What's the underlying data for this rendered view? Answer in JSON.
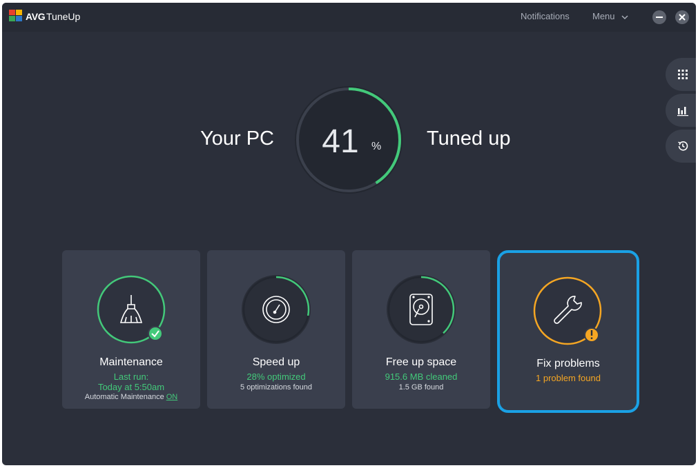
{
  "titlebar": {
    "brand": "AVG",
    "product": "TuneUp",
    "notifications": "Notifications",
    "menu": "Menu"
  },
  "hero": {
    "left_text": "Your PC",
    "percent": "41",
    "percent_sign": "%",
    "right_text": "Tuned up",
    "progress": 0.41
  },
  "cards": {
    "maintenance": {
      "title": "Maintenance",
      "line1": "Last run:",
      "line2": "Today at 5:50am",
      "line3_prefix": "Automatic Maintenance",
      "line3_link": "ON"
    },
    "speedup": {
      "title": "Speed up",
      "line1": "28% optimized",
      "line2": "5 optimizations found",
      "progress": 0.28
    },
    "freeup": {
      "title": "Free up space",
      "line1": "915.6 MB cleaned",
      "line2": "1.5 GB found",
      "progress": 0.38
    },
    "fix": {
      "title": "Fix problems",
      "line1": "1 problem found"
    }
  },
  "side_icons": [
    "apps-grid-icon",
    "bar-chart-icon",
    "history-icon"
  ],
  "colors": {
    "accent_green": "#43c97a",
    "accent_orange": "#f5a623",
    "selection_blue": "#1aa1e5",
    "background": "#2b2f3a"
  }
}
